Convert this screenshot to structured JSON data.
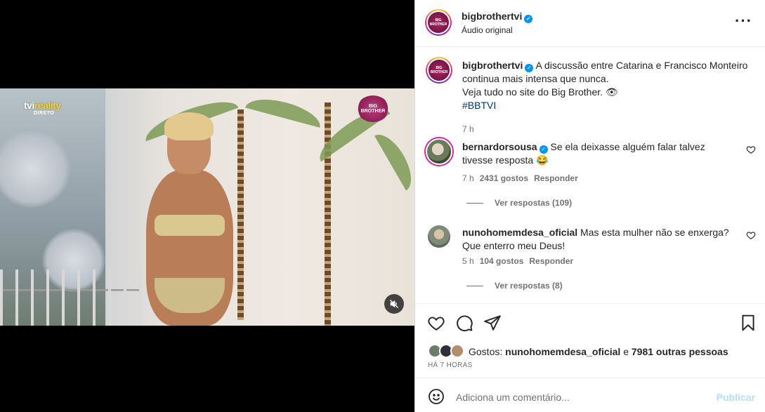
{
  "media": {
    "overlay_logo_main": "tvi",
    "overlay_logo_accent": "reality",
    "overlay_live": "DIRETO",
    "overlay_bb": "BIG BROTHER",
    "mute_icon": "speaker-muted-icon"
  },
  "post": {
    "author": "bigbrothertvi",
    "author_avatar_text": "BIG BROTHER",
    "audio": "Áudio original",
    "more_icon": "more-horizontal-icon",
    "caption_line1": "A discussão entre Catarina e Francisco Monteiro continua mais intensa que nunca.",
    "caption_line2": "Veja tudo no site do Big Brother. 👁",
    "hashtag": "#BBTVI",
    "caption_time": "7 h"
  },
  "comments": [
    {
      "user": "bernardorsousa",
      "verified": true,
      "text": "Se ela deixasse alguém falar talvez tivesse resposta 😂",
      "time": "7 h",
      "likes": "2431 gostos",
      "reply_label": "Responder",
      "view_replies": "Ver respostas (109)"
    },
    {
      "user": "nunohomemdesa_oficial",
      "verified": false,
      "text": "Mas esta mulher não se enxerga? Que enterro meu Deus!",
      "time": "5 h",
      "likes": "104 gostos",
      "reply_label": "Responder",
      "view_replies": "Ver respostas (8)"
    }
  ],
  "likes_summary": {
    "prefix": "Gostos:",
    "first_user": "nunohomemdesa_oficial",
    "joiner": "e",
    "others": "7981 outras pessoas",
    "posted_ago": "HÁ 7 HORAS"
  },
  "add_comment": {
    "placeholder": "Adiciona um comentário...",
    "post_label": "Publicar"
  },
  "colors": {
    "link_blue": "#0095f6",
    "hashtag": "#00376b",
    "muted_text": "#737373",
    "post_disabled": "#b2dffc"
  }
}
